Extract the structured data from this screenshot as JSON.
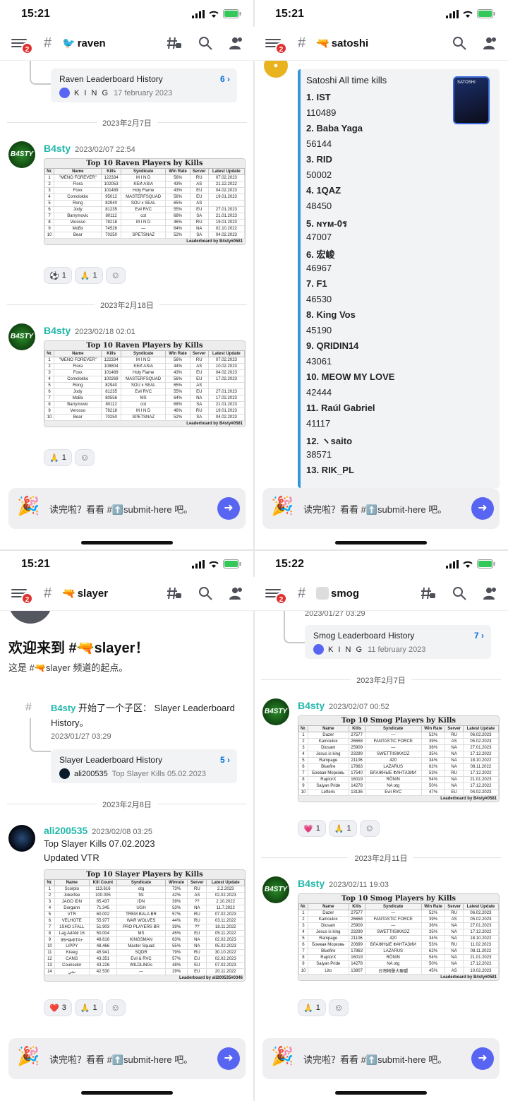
{
  "status": {
    "times": [
      "15:21",
      "15:21",
      "15:21",
      "15:22"
    ]
  },
  "composer": {
    "text": "读完啦？看看 #⬆️submit-here 吧。"
  },
  "q0": {
    "channel": "raven",
    "badge": "2",
    "thread": {
      "title": "Raven Leaderboard History",
      "count": "6 ›",
      "author": "K I N G",
      "date": "17 february 2023"
    },
    "div1": "2023年2月7日",
    "div2": "2023年2月18日",
    "msg1": {
      "user": "B4sty",
      "time": "2023/02/07 22:54",
      "avatar": "B4STY"
    },
    "msg2": {
      "user": "B4sty",
      "time": "2023/02/18 02:01",
      "avatar": "B4STY"
    },
    "table1": {
      "title": "Top 10 Raven Players by Kills",
      "headers": [
        "Nr.",
        "Name",
        "Kills",
        "Syndicate",
        "Win Rate",
        "Server",
        "Latest Update"
      ],
      "rows": [
        [
          "1",
          "\"MENO FOREVER\"",
          "122334",
          "M I N D",
          "56%",
          "RU",
          "07.02.2023"
        ],
        [
          "2",
          "Flora",
          "102053",
          "KEИ ASIA",
          "43%",
          "AS",
          "21.12.2022"
        ],
        [
          "3",
          "Foxx",
          "101489",
          "Holy Flame",
          "43%",
          "EU",
          "04.02.2023"
        ],
        [
          "4",
          "Comolokko",
          "95012",
          "MASTERFSQUAD",
          "56%",
          "EU",
          "19.01.2023"
        ],
        [
          "5",
          "Rong",
          "82940",
          "SOU x SEAL",
          "65%",
          "AS",
          ""
        ],
        [
          "6",
          "Jody",
          "81235",
          "Evil RVC",
          "55%",
          "EU",
          "27.01.2023"
        ],
        [
          "7",
          "Barrymovic",
          "80112",
          "cot",
          "68%",
          "SA",
          "21.01.2023"
        ],
        [
          "8",
          "Verosso",
          "78218",
          "M I N D",
          "46%",
          "RU",
          "19.01.2023"
        ],
        [
          "9",
          "MoBx",
          "74526",
          "—",
          "64%",
          "NA",
          "02.10.2022"
        ],
        [
          "10",
          "Bear",
          "70250",
          "SPETSNAZ",
          "52%",
          "SA",
          "04.02.2023"
        ]
      ],
      "footer": "Leaderboard by B4sty#0581"
    },
    "table2": {
      "title": "Top 10 Raven Players by Kills",
      "headers": [
        "Nr.",
        "Name",
        "Kills",
        "Syndicate",
        "Win Rate",
        "Server",
        "Latest Update"
      ],
      "rows": [
        [
          "1",
          "\"MENO FOREVER\"",
          "122334",
          "M I N D",
          "56%",
          "RU",
          "07.02.2023"
        ],
        [
          "2",
          "Flora",
          "108804",
          "KEИ ASIA",
          "44%",
          "AS",
          "10.02.2023"
        ],
        [
          "3",
          "Foxx",
          "101489",
          "Holy Flame",
          "43%",
          "EU",
          "04.02.2023"
        ],
        [
          "4",
          "Comolokko",
          "100269",
          "MASTERFSQUAD",
          "56%",
          "EU",
          "17.02.2023"
        ],
        [
          "5",
          "Rong",
          "82940",
          "SOU x SEAL",
          "65%",
          "AS",
          ""
        ],
        [
          "6",
          "Jody",
          "81235",
          "Evil RVC",
          "55%",
          "EU",
          "27.01.2023"
        ],
        [
          "7",
          "MoBx",
          "80556",
          "MS",
          "64%",
          "NA",
          "17.02.2023"
        ],
        [
          "8",
          "Barrymovic",
          "80112",
          "cot",
          "68%",
          "SA",
          "21.01.2023"
        ],
        [
          "9",
          "Verosso",
          "78218",
          "M I N D",
          "46%",
          "RU",
          "19.01.2023"
        ],
        [
          "10",
          "Bear",
          "70250",
          "SPETSNAZ",
          "52%",
          "SA",
          "04.02.2023"
        ]
      ],
      "footer": "Leaderboard by B4sty#0581"
    },
    "reacts1": [
      {
        "e": "⚽",
        "n": "1"
      },
      {
        "e": "🙏",
        "n": "1"
      }
    ],
    "reacts2": [
      {
        "e": "🙏",
        "n": "1"
      }
    ]
  },
  "q1": {
    "channel": "satoshi",
    "badge": "2",
    "embed_title": "Satoshi All time kills",
    "thumb_label": "SATOSHI",
    "entries": [
      [
        "1. IST",
        "110489"
      ],
      [
        "2. Baba Yaga",
        "56144"
      ],
      [
        "3. RID",
        "50002"
      ],
      [
        "4. 1QAZ",
        "48450"
      ],
      [
        "5. ɴʏᴍ-0ร",
        "47007"
      ],
      [
        "6. 宏峻",
        "46967"
      ],
      [
        "7. F1",
        "46530"
      ],
      [
        "8. King Vos",
        "45190"
      ],
      [
        "9. QRIDIN14",
        "43061"
      ],
      [
        "10. MEOW MY LOVE",
        "42444"
      ],
      [
        "11. Raúl Gabriel",
        "41117"
      ],
      [
        "12. ヽsaito",
        "38571"
      ],
      [
        "13. RIK_PL",
        ""
      ]
    ]
  },
  "q2": {
    "channel": "slayer",
    "badge": "2",
    "welcome": "欢迎来到 #🔫slayer！",
    "sub": "这是 #🔫slayer 频道的起点。",
    "sys": {
      "user": "B4sty",
      "text": "开始了一个子区：  Slayer Leaderboard History。",
      "date": "2023/01/27 03:29"
    },
    "thread": {
      "title": "Slayer Leaderboard History",
      "count": "5 ›",
      "author": "ali200535",
      "preview": "Top Slayer Kills 05.02.2023"
    },
    "div1": "2023年2月8日",
    "msg": {
      "user": "ali200535",
      "time": "2023/02/08 03:25",
      "line1": "Top Slayer Kills 07.02.2023",
      "line2": "Updated VTR"
    },
    "table": {
      "title": "Top 10 Slayer Players by Kills",
      "headers": [
        "Nr.",
        "Name",
        "Kill Count",
        "Syndicate",
        "Winrate",
        "Server",
        "Latest Update"
      ],
      "rows": [
        [
          "1",
          "Scorpio",
          "113.616",
          "otg",
          "73%",
          "RU",
          "2.2.2023"
        ],
        [
          "2",
          "Jokerfee",
          "100.005",
          "fAt",
          "42%",
          "AS",
          "02.02.2023"
        ],
        [
          "3",
          "JAGO IDN",
          "85.437",
          "IDN",
          "39%",
          "??",
          "2.10.2022"
        ],
        [
          "4",
          "Dorgann",
          "71.345",
          "UGH",
          "53%",
          "NA",
          "11.7.2022"
        ],
        [
          "5",
          "VTR",
          "60.002",
          "TREM BALA BR",
          "57%",
          "RU",
          "07.02.2023"
        ],
        [
          "6",
          "VELHOTE",
          "55.977",
          "WAR WOLVES",
          "44%",
          "RU",
          "03.11.2022"
        ],
        [
          "7",
          "1SHO 1FALL",
          "51.903",
          "PRO PLAYERS BR",
          "39%",
          "??",
          "18.11.2022"
        ],
        [
          "8",
          "Lag AdAM 16",
          "50.004",
          "MS",
          "45%",
          "EU",
          "05.11.2022"
        ],
        [
          "9",
          "95H⊕ΦTA+",
          "48.616",
          "KINGSMAN",
          "63%",
          "NA",
          "02.02.2023"
        ],
        [
          "10",
          "LIPPY",
          "48.466",
          "Master Squad",
          "55%",
          "NA",
          "05.02.2023"
        ],
        [
          "11",
          "Kreeg",
          "45.941",
          "SQDR",
          "79%",
          "RU",
          "30.10.2022"
        ],
        [
          "12",
          "CANG",
          "43.351",
          "Evil & RVC",
          "57%",
          "EU",
          "02.02.2023"
        ],
        [
          "13",
          "Counselor",
          "43.226",
          "WILDLINGs",
          "48%",
          "EU",
          "07.02.2023"
        ],
        [
          "14",
          "نجي",
          "42.530",
          "—",
          "29%",
          "EU",
          "20.11.2022"
        ]
      ],
      "footer": "Leaderboard by ali200535#0346"
    },
    "reacts": [
      {
        "e": "❤️",
        "n": "3"
      },
      {
        "e": "🙏",
        "n": "1"
      }
    ]
  },
  "q3": {
    "channel": "smog",
    "badge": "2",
    "thread_date": "2023/01/27 03:29",
    "thread": {
      "title": "Smog Leaderboard History",
      "count": "7 ›",
      "author": "K I N G",
      "date": "11 february 2023"
    },
    "div1": "2023年2月7日",
    "div2": "2023年2月11日",
    "msg1": {
      "user": "B4sty",
      "time": "2023/02/07 00:52",
      "avatar": "B4STY"
    },
    "msg2": {
      "user": "B4sty",
      "time": "2023/02/11 19:03",
      "avatar": "B4STY"
    },
    "table1": {
      "title": "Top 10 Smog Players by Kills",
      "headers": [
        "Nr.",
        "Name",
        "Kills",
        "Syndicate",
        "Win Rate",
        "Server",
        "Latest Update"
      ],
      "rows": [
        [
          "1",
          "Dazer",
          "27577",
          "—",
          "52%",
          "RU",
          "06.02.2023"
        ],
        [
          "2",
          "Kamoulox",
          "26658",
          "FANTASTIC FORCE",
          "39%",
          "AS",
          "05.02.2023"
        ],
        [
          "3",
          "Diosam",
          "25909",
          "—",
          "36%",
          "NA",
          "27.01.2023"
        ],
        [
          "4",
          "Jesus is king",
          "23299",
          "SWETTIISIKKOZ",
          "35%",
          "NA",
          "17.12.2022"
        ],
        [
          "5",
          "Rampage",
          "21106",
          "420",
          "34%",
          "NA",
          "18.10.2022"
        ],
        [
          "6",
          "Bluefire",
          "17863",
          "LAZARUS",
          "62%",
          "NA",
          "08.11.2022"
        ],
        [
          "7",
          "Боевая Морковь",
          "17540",
          "ВЛАЖНЫЕ ФАНТАЗИИ",
          "53%",
          "RU",
          "17.12.2022"
        ],
        [
          "8",
          "RaptorX",
          "16019",
          "RÖNIN",
          "54%",
          "NA",
          "21.01.2023"
        ],
        [
          "9",
          "Saiyan Pride",
          "14278",
          "NA otg",
          "50%",
          "NA",
          "17.12.2022"
        ],
        [
          "10",
          "Lefteris",
          "13136",
          "Evil RVC",
          "47%",
          "EU",
          "04.02.2023"
        ]
      ],
      "footer": "Leaderboard by B4sty#0581"
    },
    "table2": {
      "title": "Top 10 Smog Players by Kills",
      "headers": [
        "Nr.",
        "Name",
        "Kills",
        "Syndicate",
        "Win Rate",
        "Server",
        "Latest Update"
      ],
      "rows": [
        [
          "1",
          "Dazer",
          "27577",
          "—",
          "52%",
          "RU",
          "06.02.2023"
        ],
        [
          "2",
          "Kamoulox",
          "26658",
          "FANTASTIC FORCE",
          "39%",
          "AS",
          "05.02.2023"
        ],
        [
          "3",
          "Diosam",
          "25909",
          "—",
          "36%",
          "NA",
          "27.01.2023"
        ],
        [
          "4",
          "Jesus is king",
          "23299",
          "SWETTIISIKKOZ",
          "35%",
          "NA",
          "17.12.2022"
        ],
        [
          "5",
          "Rampage",
          "21106",
          "420",
          "34%",
          "NA",
          "18.10.2022"
        ],
        [
          "6",
          "Боевая Морковь",
          "20699",
          "ВЛАЖНЫЕ ФАНТАЗИИ",
          "53%",
          "RU",
          "11.02.2023"
        ],
        [
          "7",
          "Bluefire",
          "17863",
          "LAZARUS",
          "62%",
          "NA",
          "08.11.2022"
        ],
        [
          "8",
          "RaptorX",
          "16019",
          "RÖNIN",
          "54%",
          "NA",
          "21.01.2023"
        ],
        [
          "9",
          "Saiyan Pride",
          "14278",
          "NA otg",
          "50%",
          "NA",
          "17.12.2022"
        ],
        [
          "10",
          "Lito",
          "13807",
          "台灣物聲大聯盟",
          "45%",
          "AS",
          "10.02.2023"
        ]
      ],
      "footer": "Leaderboard by B4sty#0581"
    },
    "reacts1": [
      {
        "e": "💗",
        "n": "1"
      },
      {
        "e": "🙏",
        "n": "1"
      }
    ],
    "reacts2": [
      {
        "e": "🙏",
        "n": "1"
      }
    ]
  }
}
